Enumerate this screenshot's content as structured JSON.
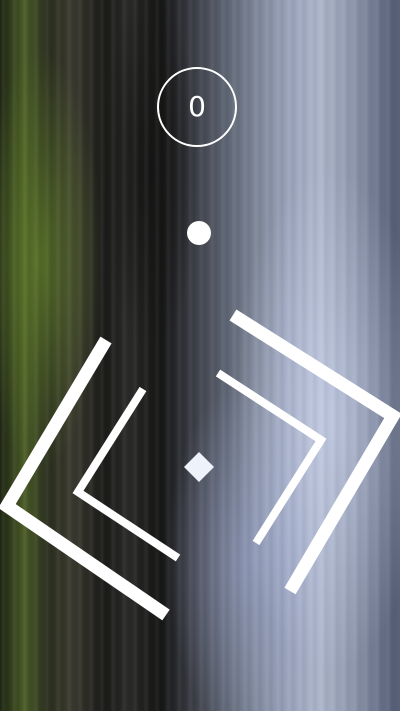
{
  "game": {
    "score": "0",
    "colors": {
      "foreground": "#ffffff"
    }
  }
}
